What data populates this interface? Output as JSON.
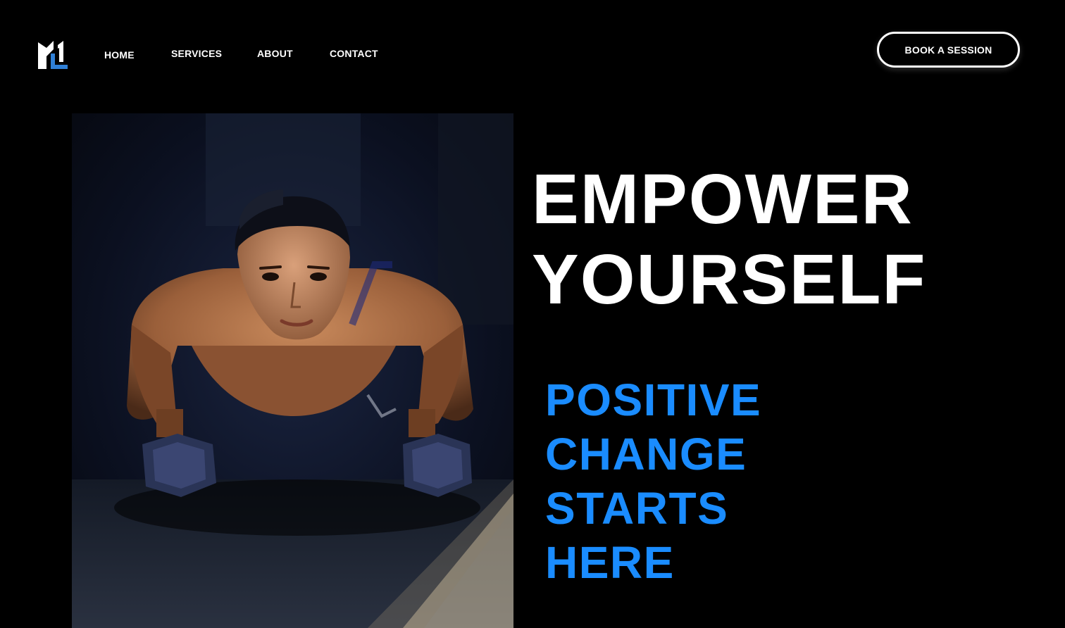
{
  "colors": {
    "background": "#000000",
    "text": "#ffffff",
    "accent": "#1a8cff",
    "logo_blue": "#2f7fd6"
  },
  "header": {
    "logo": {
      "icon": "brand-logo-icon"
    },
    "nav": {
      "home": "HOME",
      "services": "SERVICES",
      "about": "ABOUT",
      "contact": "CONTACT"
    },
    "cta_label": "BOOK A SESSION"
  },
  "hero": {
    "photo": {
      "icon": "push-up-athlete-photo"
    },
    "headline": {
      "line1": "EMPOWER",
      "line2": "YOURSELF"
    },
    "tagline": {
      "line1": "POSITIVE",
      "line2": "CHANGE",
      "line3": "STARTS",
      "line4": "HERE"
    }
  }
}
